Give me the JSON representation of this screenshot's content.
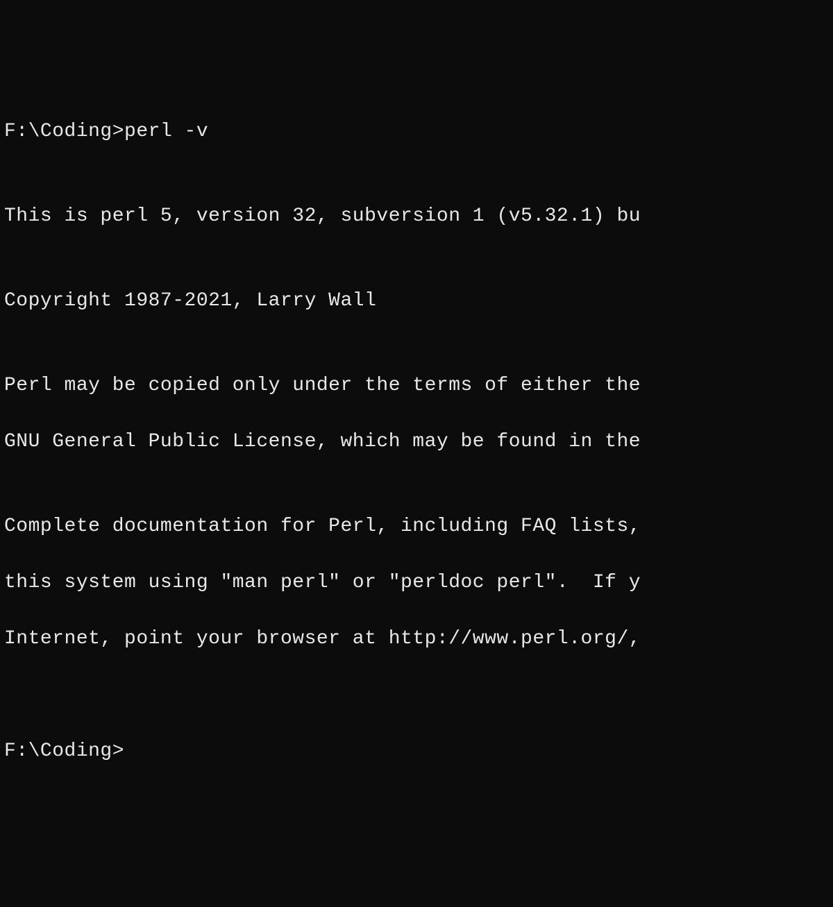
{
  "terminal": {
    "prompt1": "F:\\Coding>",
    "command": "perl -v",
    "blank": "",
    "version_line": "This is perl 5, version 32, subversion 1 (v5.32.1) bu",
    "copyright_line": "Copyright 1987-2021, Larry Wall",
    "license_line1": "Perl may be copied only under the terms of either the",
    "license_line2": "GNU General Public License, which may be found in the",
    "doc_line1": "Complete documentation for Perl, including FAQ lists,",
    "doc_line2": "this system using \"man perl\" or \"perldoc perl\".  If y",
    "doc_line3": "Internet, point your browser at http://www.perl.org/,",
    "prompt2": "F:\\Coding>"
  }
}
